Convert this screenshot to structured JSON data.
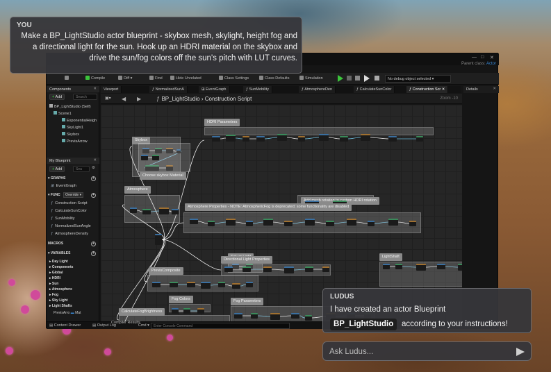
{
  "user_message": {
    "author": "YOU",
    "text": "Make a BP_LightStudio actor blueprint - skybox mesh, skylight, height fog and a directional light for the sun. Hook up an HDRI material on the skybox and drive the sun/fog colors off the sun's pitch with LUT curves."
  },
  "assistant_message": {
    "author": "LUDUS",
    "line1": "I have created an actor Blueprint",
    "chip": "BP_LightStudio",
    "line2": "according to your instructions!"
  },
  "ask_input": {
    "placeholder": "Ask Ludus..."
  },
  "editor": {
    "titlebar": {
      "parent_class": "Parent class:",
      "parent_value": "Actor"
    },
    "toolbar": {
      "compile": "Compile",
      "diff": "Diff",
      "find": "Find",
      "hide_unrelated": "Hide Unrelated",
      "class_settings": "Class Settings",
      "class_defaults": "Class Defaults",
      "simulation": "Simulation",
      "debug_object": "No debug object selected"
    },
    "components": {
      "title": "Components",
      "add": "Add",
      "search_placeholder": "Search",
      "items": [
        "BP_LightStudio (Self)",
        "Scene1",
        "ExponentialHeigh",
        "SkyLight1",
        "Skybox",
        "PrevisArrow"
      ]
    },
    "my_blueprint": {
      "title": "My Blueprint",
      "add": "Add",
      "search_placeholder": "Sea",
      "graphs_label": "GRAPHS",
      "event_graph": "EventGraph",
      "functions_label": "FUNC",
      "override_label": "Override",
      "functions": [
        "Construction Script",
        "CalculateSunColor",
        "SunMobility",
        "NormalizedSunAngle",
        "AtmosphereDensity"
      ],
      "macros_label": "MACROS",
      "variables_label": "VARIABLES",
      "variables": [
        "Day Light",
        "Components",
        "Global",
        "HDRI",
        "Sun",
        "Atmosphere",
        "Fog",
        "Sky Light",
        "Light Shafts"
      ],
      "last_var": "PrevisArro",
      "last_var_type": "Mat"
    },
    "tabs": [
      "Viewport",
      "NormalizedSunA",
      "EventGraph",
      "SunMobility",
      "AtmosphereDen",
      "CalculateSunColor",
      "Construction Scr"
    ],
    "details_tab": "Details",
    "breadcrumb": {
      "blueprint": "BP_LightStudio",
      "graph": "Construction Script"
    },
    "zoom": "Zoom -10",
    "comments": [
      "Skybox",
      "HDRI Parameters",
      "Choose skybox Material",
      "Add mesh rotation to custom HDRI rotation",
      "Atmosphere",
      "Atmosphere Properties - NOTE: AtmosphericFog is deprecated; some functionality are disabled",
      "Set up Light",
      "Directional Light Properties",
      "LightShaft",
      "PrevisComposite",
      "Fog Colors",
      "Fog Parameters",
      "CalculateFogBrightness",
      "Recapture Skylight"
    ],
    "bottom": {
      "content_drawer": "Content Drawer",
      "output_log": "Output Log",
      "compile_results": "Compiler Results",
      "cmd": "Cmd",
      "console_placeholder": "Enter Console Command"
    }
  }
}
